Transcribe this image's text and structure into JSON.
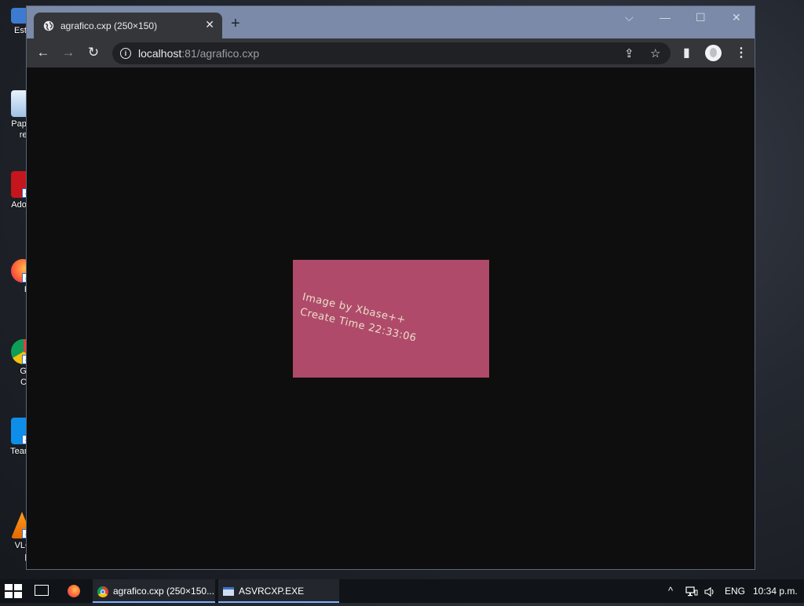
{
  "desktop": {
    "icons": [
      {
        "label": "Este",
        "label2": ""
      },
      {
        "label": "Pape",
        "label2": "rec"
      },
      {
        "label": "Adob",
        "label2": ""
      },
      {
        "label": "Fi",
        "label2": ""
      },
      {
        "label": "Go",
        "label2": "Ch"
      },
      {
        "label": "Team",
        "label2": ""
      },
      {
        "label": "VLC",
        "label2": "pl"
      }
    ]
  },
  "browser": {
    "tab_title": "agrafico.cxp (250×150)",
    "tab_close": "✕",
    "new_tab": "+",
    "window_controls": {
      "dropdown": "⌵",
      "minimize": "—",
      "maximize": "☐",
      "close": "✕"
    },
    "nav": {
      "back": "←",
      "forward": "→",
      "reload": "↻"
    },
    "url_host": "localhost",
    "url_rest": ":81/agrafico.cxp",
    "icons": {
      "share": "⇪",
      "bookmark": "☆",
      "sidepanel": "▮",
      "menu": "⋮"
    }
  },
  "image": {
    "line1": "Image by Xbase++",
    "line2": "Create Time 22:33:06",
    "background": "#b04a6a"
  },
  "taskbar": {
    "items": [
      {
        "label": "agrafico.cxp (250×150..."
      },
      {
        "label": "ASVRCXP.EXE"
      }
    ],
    "tray": {
      "chevron": "^",
      "language": "ENG",
      "time": "10:34 p.m."
    }
  }
}
